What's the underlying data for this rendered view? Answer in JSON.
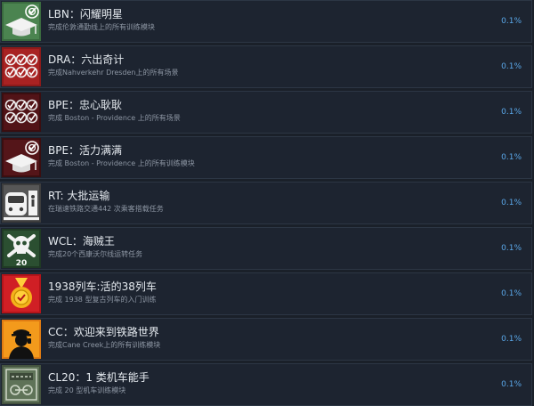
{
  "achievements": [
    {
      "title": "LBN：闪耀明星",
      "desc": "完成伦敦通勤线上的所有训练模块",
      "percent": "0.1%",
      "icon": "graduation-cap-icon"
    },
    {
      "title": "DRA：六出奇计",
      "desc": "完成Nahverkehr Dresden上的所有场景",
      "percent": "0.1%",
      "icon": "six-checkmarks-icon"
    },
    {
      "title": "BPE：忠心耿耿",
      "desc": "完成 Boston - Providence 上的所有场景",
      "percent": "0.1%",
      "icon": "six-checkmarks-icon"
    },
    {
      "title": "BPE：活力满满",
      "desc": "完成 Boston - Providence 上的所有训练模块",
      "percent": "0.1%",
      "icon": "graduation-cap-icon"
    },
    {
      "title": "RT: 大批运输",
      "desc": "在瑞速铁路交通442 次乘客搭载任务",
      "percent": "0.1%",
      "icon": "train-front-icon"
    },
    {
      "title": "WCL：海贼王",
      "desc": "完成20个西康沃尔线运转任务",
      "percent": "0.1%",
      "icon": "skull-crossbones-icon",
      "badge": "20"
    },
    {
      "title": "1938列车:活的38列车",
      "desc": "完成 1938 型复古列车的入门训练",
      "percent": "0.1%",
      "icon": "medal-icon"
    },
    {
      "title": "CC：欢迎来到铁路世界",
      "desc": "完成Cane Creek上的所有训练模块",
      "percent": "0.1%",
      "icon": "conductor-silhouette-icon"
    },
    {
      "title": "CL20：1 类机车能手",
      "desc": "完成 20 型机车训练模块",
      "percent": "0.1%",
      "icon": "locomotive-plate-icon"
    }
  ]
}
